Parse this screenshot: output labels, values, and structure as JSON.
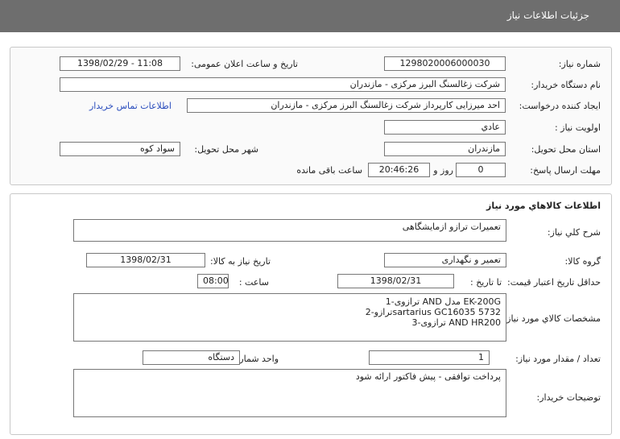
{
  "header": {
    "title": "جزئیات اطلاعات نیاز"
  },
  "info": {
    "need_number_label": "شماره نیاز:",
    "need_number": "1298020006000030",
    "announce_label": "تاریخ و ساعت اعلان عمومی:",
    "announce_value": "1398/02/29 - 11:08",
    "buyer_label": "نام دستگاه خریدار:",
    "buyer_value": "شرکت زغالسنگ البرز مرکزی - مازندران",
    "requester_label": "ایجاد کننده درخواست:",
    "requester_value": "احد میرزایی کارپرداز شرکت زغالسنگ البرز مرکزی - مازندران",
    "contact_link": "اطلاعات تماس خریدار",
    "priority_label": "اولویت نیاز :",
    "priority_value": "عادي",
    "province_label": "استان محل تحویل:",
    "province_value": "مازندران",
    "city_label": "شهر محل تحویل:",
    "city_value": "سواد کوه",
    "deadline_label": "مهلت ارسال پاسخ:",
    "days_value": "0",
    "days_label": "روز و",
    "time_value": "20:46:26",
    "remaining_label": "ساعت باقی مانده"
  },
  "goods": {
    "section_title": "اطلاعات کالاهاي مورد نياز",
    "summary_label": "شرح کلي نياز:",
    "summary_value": "تعمیرات ترازو ازمایشگاهی",
    "group_label": "گروه کالا:",
    "group_value": "تعمیر و نگهداری",
    "need_date_label": "تاريخ نياز به کالا:",
    "need_date_value": "1398/02/31",
    "validity_label": "حداقل تاريخ اعتبار قيمت:",
    "until_date_label": "تا تاريخ :",
    "until_date_value": "1398/02/31",
    "hour_label": "ساعت :",
    "hour_value": "08:00",
    "specs_label": "مشخصات کالاي مورد نياز:",
    "specs_lines": [
      "1-ترازوی AND مدل EK-200G",
      "2-ترازوsartarius  GC16035 5732",
      "3-ترازوی AND HR200"
    ],
    "qty_label": "تعداد / مقدار مورد نياز:",
    "qty_value": "1",
    "unit_label": "واحد شمارش:",
    "unit_value": "دستگاه",
    "buyer_notes_label": "توضيحات خريدار:",
    "buyer_notes_value": "پرداخت توافقی - پیش فاکتور ارائه شود"
  }
}
